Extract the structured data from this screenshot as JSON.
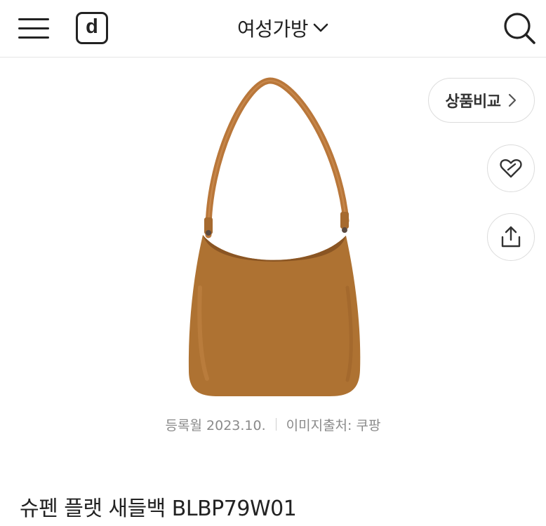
{
  "header": {
    "logo_text": "d",
    "category_label": "여성가방",
    "icons": {
      "menu": "hamburger-menu-icon",
      "category_toggle": "chevron-down-icon",
      "search": "search-icon"
    }
  },
  "product": {
    "image_alt": "tan leather hobo shoulder bag",
    "compare_label": "상품비교",
    "registered": "등록월 2023.10.",
    "image_source": "이미지출처: 쿠팡",
    "title": "슈펜 플랫 새들백 BLBP79W01"
  },
  "actions": {
    "like_icon": "heart-tag-icon",
    "share_icon": "share-icon",
    "compare_icon": "chevron-right-icon"
  },
  "colors": {
    "bag": "#ae7232",
    "bag_dark": "#8a5523",
    "text": "#222222",
    "muted": "#8a8a8a",
    "border": "#dcdcdc"
  }
}
